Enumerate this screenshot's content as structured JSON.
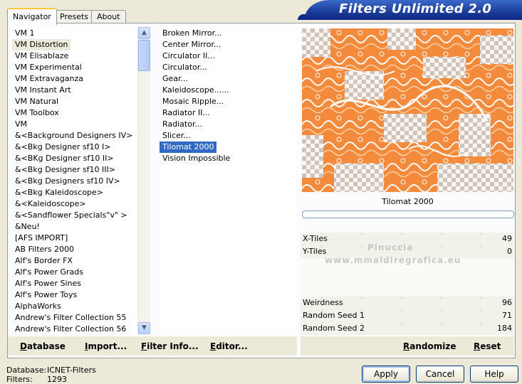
{
  "tabs": [
    "Navigator",
    "Presets",
    "About"
  ],
  "app_title": "Filters Unlimited 2.0",
  "categories": [
    "VM 1",
    "VM Distortion",
    "VM Elisablaze",
    "VM Experimental",
    "VM Extravaganza",
    "VM Instant Art",
    "VM Natural",
    "VM Toolbox",
    "VM",
    "&<Background Designers IV>",
    "&<Bkg Designer sf10 I>",
    "&<BKg Designer sf10 II>",
    "&<Bkg Designer sf10 III>",
    "&<Bkg Designers sf10 IV>",
    "&<Bkg Kaleidoscope>",
    "&<Kaleidoscope>",
    "&<Sandflower Specials\"v\" >",
    "&Neu!",
    "[AFS IMPORT]",
    "AB Filters 2000",
    "Alf's Border FX",
    "Alf's Power Grads",
    "Alf's Power Sines",
    "Alf's Power Toys",
    "AlphaWorks",
    "Andrew's Filter Collection 55",
    "Andrew's Filter Collection 56"
  ],
  "selected_category": "VM Distortion",
  "filters": [
    "Broken Mirror...",
    "Center Mirror...",
    "Circulator II...",
    "Circulator...",
    "Gear...",
    "Kaleidoscope......",
    "Mosaic Ripple...",
    "Radiator II...",
    "Radiator...",
    "Slicer...",
    "Tilomat 2000",
    "Vision Impossible"
  ],
  "selected_filter": "Tilomat 2000",
  "preview_caption": "Tilomat 2000",
  "params": [
    {
      "label": "X-Tiles",
      "value": "49"
    },
    {
      "label": "Y-Tiles",
      "value": "0"
    },
    {
      "label": "",
      "value": ""
    },
    {
      "label": "",
      "value": ""
    },
    {
      "label": "",
      "value": ""
    },
    {
      "label": "Weirdness",
      "value": "96"
    },
    {
      "label": "Random Seed 1",
      "value": "71"
    },
    {
      "label": "Random Seed 2",
      "value": "184"
    }
  ],
  "watermark": {
    "line1": "Pinuccia",
    "line2": "www.mmaldiregrafica.eu"
  },
  "toolbar": {
    "database": "Database",
    "import": "Import...",
    "filter_info": "Filter Info...",
    "editor": "Editor...",
    "randomize": "Randomize",
    "reset": "Reset"
  },
  "footer": {
    "database_label": "Database:",
    "database_value": "ICNET-Filters",
    "filters_label": "Filters:",
    "filters_value": "1293",
    "apply": "Apply",
    "cancel": "Cancel",
    "help": "Help"
  },
  "colors": {
    "accent": "#316ac5",
    "preview_orange": "#f48a3c",
    "banner": "#1f3f9c"
  }
}
